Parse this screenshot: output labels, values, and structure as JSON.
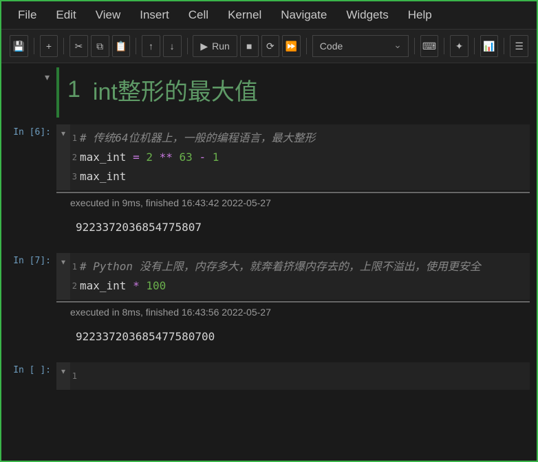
{
  "menubar": {
    "items": [
      "File",
      "Edit",
      "View",
      "Insert",
      "Cell",
      "Kernel",
      "Navigate",
      "Widgets",
      "Help"
    ]
  },
  "toolbar": {
    "run_label": "Run",
    "cell_type": "Code"
  },
  "heading": {
    "number": "1",
    "title": "int整形的最大值"
  },
  "cells": [
    {
      "prompt": "In [6]:",
      "lines": [
        {
          "num": "1",
          "tokens": [
            {
              "t": "comment",
              "v": "# 传统64位机器上，一般的编程语言，最大整形"
            }
          ]
        },
        {
          "num": "2",
          "tokens": [
            {
              "t": "name",
              "v": "max_int"
            },
            {
              "t": "name",
              "v": " "
            },
            {
              "t": "op",
              "v": "="
            },
            {
              "t": "name",
              "v": " "
            },
            {
              "t": "num",
              "v": "2"
            },
            {
              "t": "name",
              "v": " "
            },
            {
              "t": "op",
              "v": "**"
            },
            {
              "t": "name",
              "v": " "
            },
            {
              "t": "num",
              "v": "63"
            },
            {
              "t": "name",
              "v": " "
            },
            {
              "t": "op",
              "v": "-"
            },
            {
              "t": "name",
              "v": " "
            },
            {
              "t": "num",
              "v": "1"
            }
          ]
        },
        {
          "num": "3",
          "tokens": [
            {
              "t": "name",
              "v": "max_int"
            }
          ]
        }
      ],
      "exec": "executed in 9ms, finished 16:43:42 2022-05-27",
      "output": "9223372036854775807"
    },
    {
      "prompt": "In [7]:",
      "lines": [
        {
          "num": "1",
          "tokens": [
            {
              "t": "comment",
              "v": "# Python 没有上限，内存多大，就奔着挤爆内存去的，上限不溢出，使用更安全"
            }
          ]
        },
        {
          "num": "2",
          "tokens": [
            {
              "t": "name",
              "v": "max_int"
            },
            {
              "t": "name",
              "v": " "
            },
            {
              "t": "op",
              "v": "*"
            },
            {
              "t": "name",
              "v": " "
            },
            {
              "t": "num",
              "v": "100"
            }
          ]
        }
      ],
      "exec": "executed in 8ms, finished 16:43:56 2022-05-27",
      "output": "922337203685477580700"
    },
    {
      "prompt": "In [ ]:",
      "lines": [
        {
          "num": "1",
          "tokens": []
        }
      ],
      "exec": null,
      "output": null
    }
  ]
}
